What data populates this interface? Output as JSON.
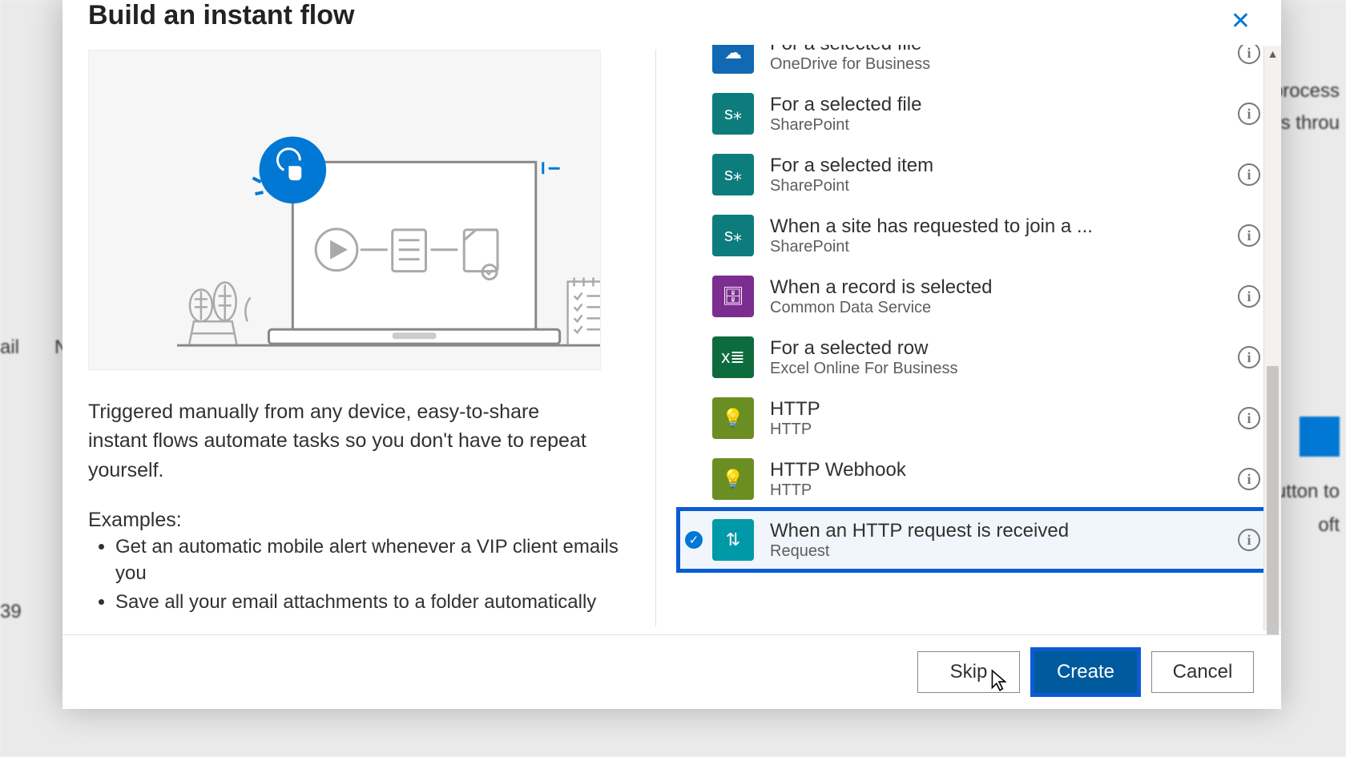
{
  "modal": {
    "title": "Build an instant flow",
    "footer": {
      "skip": "Skip",
      "create": "Create",
      "cancel": "Cancel"
    }
  },
  "left": {
    "description": "Triggered manually from any device, easy-to-share instant flows automate tasks so you don't have to repeat yourself.",
    "examplesLabel": "Examples:",
    "examples": [
      "Get an automatic mobile alert whenever a VIP client emails you",
      "Save all your email attachments to a folder automatically"
    ]
  },
  "triggers": [
    {
      "title": "For a selected file",
      "sub": "OneDrive for Business",
      "iconClass": "ic-onedrive",
      "iconName": "onedrive-icon",
      "glyph": "☁",
      "truncatedTitle": true
    },
    {
      "title": "For a selected file",
      "sub": "SharePoint",
      "iconClass": "ic-sharepoint",
      "iconName": "sharepoint-icon",
      "glyph": "s⁎"
    },
    {
      "title": "For a selected item",
      "sub": "SharePoint",
      "iconClass": "ic-sharepoint",
      "iconName": "sharepoint-icon",
      "glyph": "s⁎"
    },
    {
      "title": "When a site has requested to join a ...",
      "sub": "SharePoint",
      "iconClass": "ic-sharepoint",
      "iconName": "sharepoint-icon",
      "glyph": "s⁎"
    },
    {
      "title": "When a record is selected",
      "sub": "Common Data Service",
      "iconClass": "ic-cds",
      "iconName": "database-icon",
      "glyph": "🗄"
    },
    {
      "title": "For a selected row",
      "sub": "Excel Online For Business",
      "iconClass": "ic-excel",
      "iconName": "excel-icon",
      "glyph": "x≣"
    },
    {
      "title": "HTTP",
      "sub": "HTTP",
      "iconClass": "ic-http",
      "iconName": "lightbulb-icon",
      "glyph": "💡"
    },
    {
      "title": "HTTP Webhook",
      "sub": "HTTP",
      "iconClass": "ic-http",
      "iconName": "lightbulb-icon",
      "glyph": "💡"
    },
    {
      "title": "When an HTTP request is received",
      "sub": "Request",
      "iconClass": "ic-request",
      "iconName": "request-icon",
      "glyph": "⇅",
      "selected": true,
      "highlight": true
    }
  ],
  "bg": {
    "t1": "process",
    "t2": "rs throu",
    "t3": "button to",
    "t4": "oft",
    "t5": "ail",
    "t6": "N",
    "t7": "39"
  }
}
